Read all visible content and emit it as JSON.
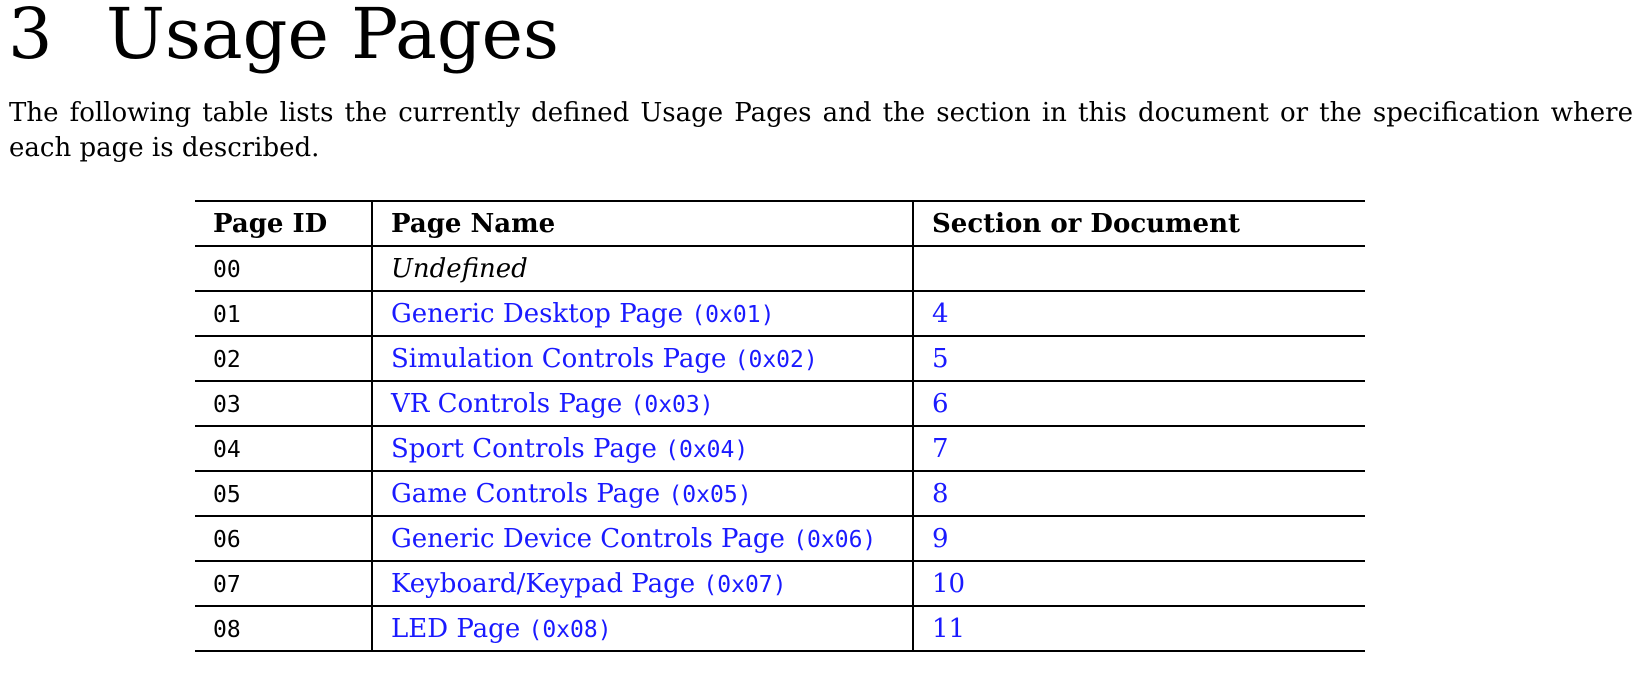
{
  "section": {
    "number": "3",
    "title": "Usage Pages",
    "intro": "The following table lists the currently defined Usage Pages and the section in this document or the specification where each page is described."
  },
  "table": {
    "headers": [
      "Page ID",
      "Page Name",
      "Section or Document"
    ],
    "rows": [
      {
        "id": "00",
        "name": "Undefined",
        "code": "",
        "ref": ""
      },
      {
        "id": "01",
        "name": "Generic Desktop Page",
        "code": "(0x01)",
        "ref": "4"
      },
      {
        "id": "02",
        "name": "Simulation Controls Page",
        "code": "(0x02)",
        "ref": "5"
      },
      {
        "id": "03",
        "name": "VR Controls Page",
        "code": "(0x03)",
        "ref": "6"
      },
      {
        "id": "04",
        "name": "Sport Controls Page",
        "code": "(0x04)",
        "ref": "7"
      },
      {
        "id": "05",
        "name": "Game Controls Page",
        "code": "(0x05)",
        "ref": "8"
      },
      {
        "id": "06",
        "name": "Generic Device Controls Page",
        "code": "(0x06)",
        "ref": "9"
      },
      {
        "id": "07",
        "name": "Keyboard/Keypad Page",
        "code": "(0x07)",
        "ref": "10"
      },
      {
        "id": "08",
        "name": "LED Page",
        "code": "(0x08)",
        "ref": "11"
      }
    ]
  },
  "colors": {
    "link": "#1a1aff",
    "text": "#000000",
    "background": "#ffffff"
  }
}
